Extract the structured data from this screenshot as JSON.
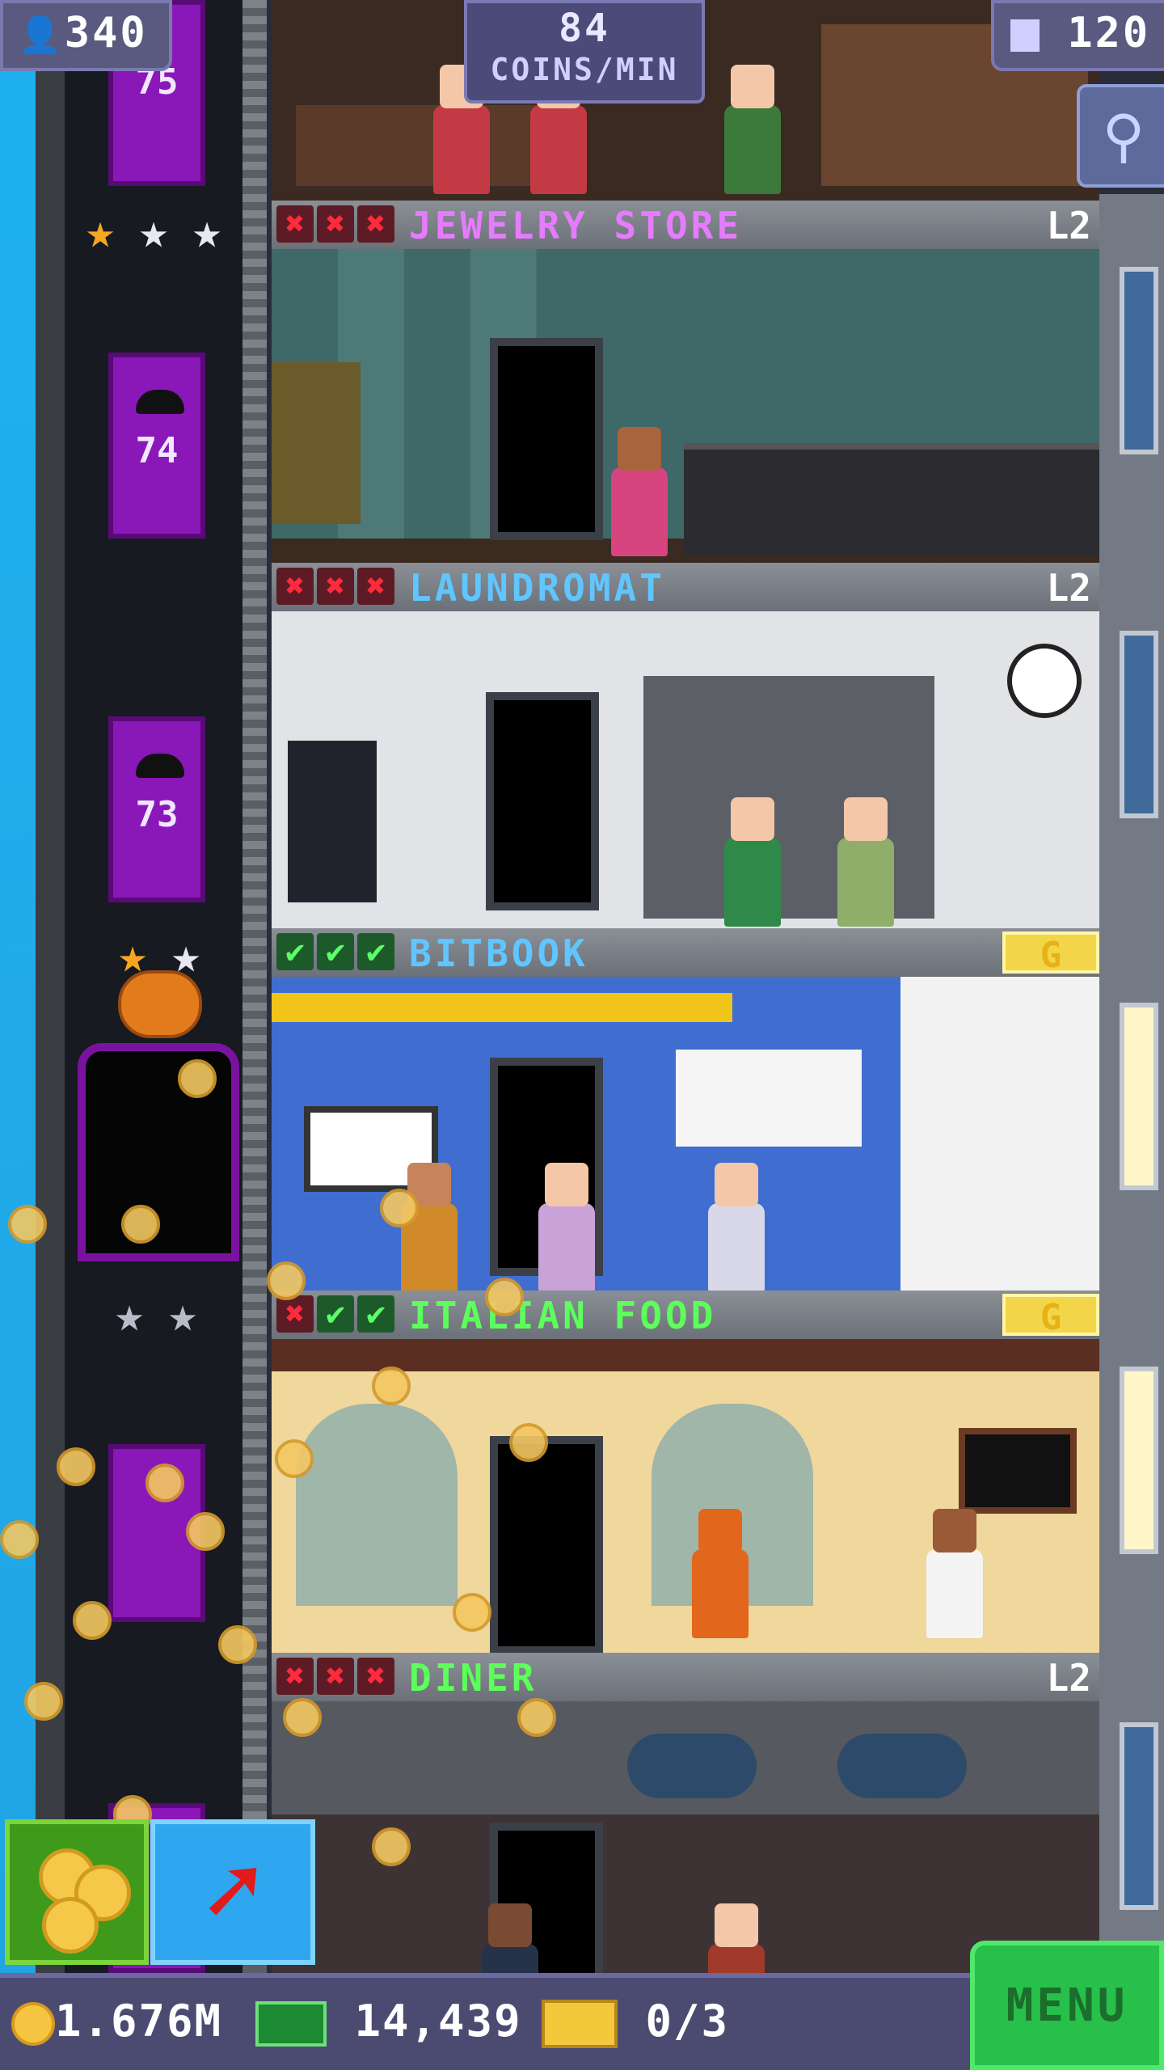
{
  "hud": {
    "population": "340",
    "rate_value": "84",
    "rate_unit": "COINS/MIN",
    "floor_count": "120"
  },
  "elevator": {
    "floors": [
      "75",
      "74",
      "73"
    ]
  },
  "floors": [
    {
      "name": "JEWELRY STORE",
      "name_color": "#e77bff",
      "marks": [
        "x",
        "x",
        "x"
      ],
      "badge": "L2"
    },
    {
      "name": "LAUNDROMAT",
      "name_color": "#5fc6ff",
      "marks": [
        "x",
        "x",
        "x"
      ],
      "badge": "L2"
    },
    {
      "name": "BITBOOK",
      "name_color": "#5fc6ff",
      "marks": [
        "c",
        "c",
        "c"
      ],
      "badge": "G"
    },
    {
      "name": "ITALIAN FOOD",
      "name_color": "#5dff5a",
      "marks": [
        "x",
        "c",
        "c"
      ],
      "badge": "G"
    },
    {
      "name": "DINER",
      "name_color": "#5dff5a",
      "marks": [
        "x",
        "x",
        "x"
      ],
      "badge": "L2"
    }
  ],
  "bottom": {
    "coins": "1.676M",
    "bux": "14,439",
    "tickets": "0/3",
    "menu_label": "MENU"
  },
  "colors": {
    "elevator": "#8a17b8",
    "menu": "#27c04a",
    "sky": "#1fb1f0"
  }
}
